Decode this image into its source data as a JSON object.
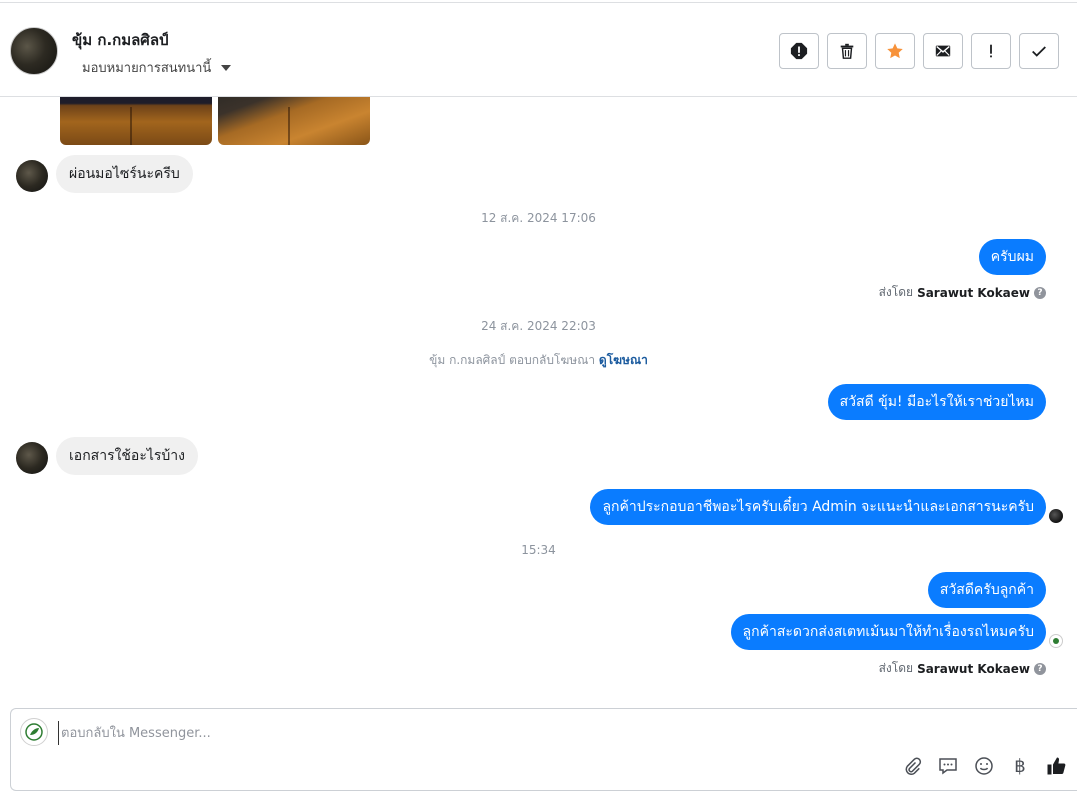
{
  "header": {
    "contact_name": "ขุ้ม ก.กมลศิลป์",
    "assign_label": "มอบหมายการสนทนานี้"
  },
  "toolbar": {
    "icons": [
      "alert-icon",
      "trash-icon",
      "star-icon",
      "mail-icon",
      "exclamation-icon",
      "check-icon"
    ],
    "star_color": "#f7923a"
  },
  "messages": {
    "m1_in": "ผ่อนมอไซร์นะครีบ",
    "ts1": "12 ส.ค. 2024 17:06",
    "m2_out": "ครับผม",
    "sent_by_prefix": "ส่งโดย",
    "sent_by_name": "Sarawut Kokaew",
    "ts2": "24 ส.ค. 2024 22:03",
    "ad_text": "ขุ้ม ก.กมลศิลป์ ตอบกลับโฆษณา",
    "ad_link": "ดูโฆษณา",
    "m3_out": "สวัสดี ขุ้ม! มีอะไรให้เราช่วยไหม",
    "m4_in": "เอกสารใช้อะไรบ้าง",
    "m5_out": "ลูกค้าประกอบอาชีพอะไรครับเดี๋ยว Admin จะแนะนำและเอกสารนะครับ",
    "ts3": "15:34",
    "m6_out": "สวัสดีครับลูกค้า",
    "m7_out": "ลูกค้าสะดวกส่งสเตทเม้นมาให้ทำเรื่องรถไหมครับ"
  },
  "composer": {
    "placeholder": "ตอบกลับใน Messenger...",
    "tools": [
      "paperclip-icon",
      "chat-icon",
      "emoji-icon",
      "baht-icon",
      "thumbs-up-icon"
    ],
    "baht_symbol": "฿"
  },
  "colors": {
    "outgoing_bubble": "#0a7cff",
    "incoming_bubble": "#f0f0f0"
  }
}
